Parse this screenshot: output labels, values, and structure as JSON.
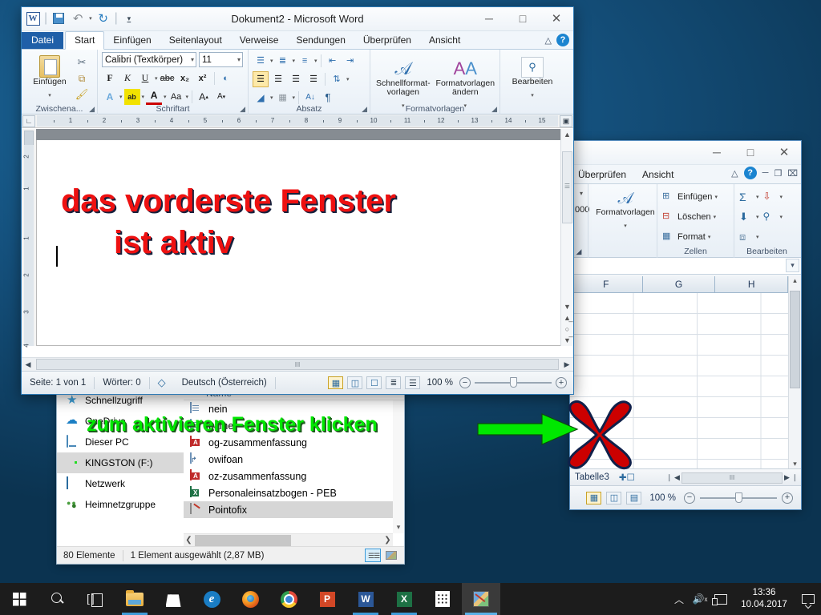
{
  "colors": {
    "annotation_green": "#00E800",
    "annotation_red": "#CC0000",
    "word_red_text": "#EE1111",
    "word_accent": "#2E7AB5",
    "taskbar": "#1C1C1C"
  },
  "word": {
    "title": "Dokument2  -  Microsoft Word",
    "quick_access": [
      {
        "name": "word-logo-icon",
        "label": "W"
      },
      {
        "name": "save-icon",
        "label": "Speichern"
      },
      {
        "name": "undo-icon",
        "label": "Rückgängig"
      },
      {
        "name": "redo-icon",
        "label": "Wiederholen"
      },
      {
        "name": "customize-qat-icon",
        "label": "Symbolleiste anpassen"
      }
    ],
    "window_buttons": {
      "minimize": "─",
      "maximize": "□",
      "close": "✕"
    },
    "tabs": [
      {
        "label": "Datei",
        "type": "file"
      },
      {
        "label": "Start",
        "active": true
      },
      {
        "label": "Einfügen"
      },
      {
        "label": "Seitenlayout"
      },
      {
        "label": "Verweise"
      },
      {
        "label": "Sendungen"
      },
      {
        "label": "Überprüfen"
      },
      {
        "label": "Ansicht"
      }
    ],
    "ribbon": {
      "clipboard": {
        "group_label": "Zwischena...",
        "paste_label": "Einfügen",
        "cut": "Ausschneiden",
        "copy": "Kopieren",
        "format_painter": "Format übertragen"
      },
      "font": {
        "group_label": "Schriftart",
        "font_name": "Calibri (Textkörper)",
        "font_size": "11",
        "bold": "F",
        "italic": "K",
        "underline": "U",
        "strike": "abc",
        "subscript": "x₂",
        "superscript": "x²",
        "clear_format": "Aa",
        "text_effects": "A",
        "highlight": "ab",
        "font_color": "A",
        "change_case": "Aa",
        "grow_font": "A▴",
        "shrink_font": "A▾"
      },
      "paragraph": {
        "group_label": "Absatz",
        "bullets": "Aufzählungszeichen",
        "numbering": "Nummerierung",
        "multilevel": "Liste mit mehreren Ebenen",
        "decrease_indent": "Einzug verkleinern",
        "increase_indent": "Einzug vergrößern",
        "align_left": "Linksbündig",
        "align_center": "Zentriert",
        "align_right": "Rechtsbündig",
        "justify": "Blocksatz",
        "line_spacing": "Zeilenabstand",
        "shading": "Schattierung",
        "borders": "Rahmen",
        "sort": "Sortieren",
        "show_marks": "¶"
      },
      "styles": {
        "group_label": "Formatvorlagen",
        "quick_styles": "Schnellformat-\nvorlagen",
        "quick_styles_l1": "Schnellformat-",
        "quick_styles_l2": "vorlagen",
        "change_styles_l1": "Formatvorlagen",
        "change_styles_l2": "ändern"
      },
      "editing": {
        "group_label": "",
        "edit_label": "Bearbeiten"
      }
    },
    "ruler": {
      "numbers": [
        "1",
        "2",
        "3",
        "4",
        "5",
        "6",
        "7",
        "8",
        "9",
        "10",
        "11",
        "12",
        "13",
        "14",
        "15"
      ],
      "vertical_numbers": [
        "2",
        "1",
        "1",
        "2",
        "3",
        "4"
      ]
    },
    "document": {
      "line1": "das vorderste Fenster",
      "line2": "ist aktiv"
    },
    "status": {
      "page": "Seite: 1 von 1",
      "words": "Wörter: 0",
      "language": "Deutsch (Österreich)",
      "zoom": "100 %",
      "proofing_icon": "proofing-errors-icon",
      "views": [
        "print-layout-view",
        "fullscreen-reading-view",
        "web-layout-view",
        "outline-view",
        "draft-view"
      ]
    }
  },
  "excel": {
    "window_buttons": {
      "minimize": "─",
      "maximize": "□",
      "close": "✕"
    },
    "tabs": [
      {
        "label": "Überprüfen"
      },
      {
        "label": "Ansicht"
      }
    ],
    "tab_right": [
      {
        "name": "collapse-ribbon-icon",
        "label": "△"
      },
      {
        "name": "help-icon",
        "label": "?"
      },
      {
        "name": "minimize-workbook-icon",
        "label": "─"
      },
      {
        "name": "restore-workbook-icon",
        "label": "❐"
      },
      {
        "name": "close-workbook-icon",
        "label": "⌧"
      }
    ],
    "ribbon": {
      "number_partial": "000",
      "styles_label": "Formatvorlagen",
      "cells": {
        "group_label": "Zellen",
        "insert": "Einfügen",
        "delete": "Löschen",
        "format": "Format"
      },
      "editing": {
        "group_label": "Bearbeiten",
        "autosum": "Σ",
        "sort_filter": "Sortieren und Filtern",
        "fill": "Füllbereich",
        "find_select": "Suchen und Auswählen",
        "clear": "Löschen"
      }
    },
    "columns": [
      "F",
      "G",
      "H"
    ],
    "sheet_tab": "Tabelle3",
    "new_sheet_icon": "new-sheet-icon",
    "status": {
      "zoom": "100 %",
      "views": [
        "normal-view",
        "page-layout-view",
        "page-break-view"
      ]
    }
  },
  "explorer": {
    "nav_items": [
      {
        "label": "Schnellzugriff",
        "icon": "star-icon"
      },
      {
        "label": "OneDrive",
        "icon": "cloud-icon"
      },
      {
        "label": "Dieser PC",
        "icon": "computer-icon"
      },
      {
        "label": "KINGSTON (F:)",
        "icon": "usb-drive-icon",
        "selected": true
      },
      {
        "label": "Netzwerk",
        "icon": "network-icon"
      },
      {
        "label": "Heimnetzgruppe",
        "icon": "homegroup-icon"
      }
    ],
    "column_header": "Name",
    "files": [
      {
        "label": "nein",
        "icon": "document-icon"
      },
      {
        "label": "name",
        "icon": "document-icon"
      },
      {
        "label": "og-zusammenfassung",
        "icon": "pdf-icon"
      },
      {
        "label": "owifoan",
        "icon": "shortcut-icon"
      },
      {
        "label": "oz-zusammenfassung",
        "icon": "pdf-icon"
      },
      {
        "label": "Personaleinsatzbogen - PEB",
        "icon": "excel-icon"
      },
      {
        "label": "Pointofix",
        "icon": "pointofix-icon",
        "selected": true
      }
    ],
    "status": {
      "item_count": "80 Elemente",
      "selection": "1 Element ausgewählt (2,87 MB)"
    },
    "view_buttons": [
      {
        "name": "details-view-button",
        "active": true
      },
      {
        "name": "large-icons-view-button",
        "active": false
      }
    ]
  },
  "annotations": {
    "green_text": "zum aktivieren Fenster klicken",
    "arrow": "green-arrow-icon",
    "cross": "red-x-icon"
  },
  "taskbar": {
    "items": [
      {
        "name": "start-button",
        "icon": "windows-logo-icon",
        "label": "Start"
      },
      {
        "name": "search-button",
        "icon": "search-icon",
        "label": "Suchen"
      },
      {
        "name": "task-view-button",
        "icon": "task-view-icon",
        "label": "Taskansicht"
      },
      {
        "name": "file-explorer-button",
        "icon": "folder-icon",
        "label": "Explorer",
        "state": "open"
      },
      {
        "name": "store-button",
        "icon": "store-icon",
        "label": "Store"
      },
      {
        "name": "edge-button",
        "icon": "edge-icon",
        "label": "Microsoft Edge"
      },
      {
        "name": "firefox-button",
        "icon": "firefox-icon",
        "label": "Firefox"
      },
      {
        "name": "chrome-button",
        "icon": "chrome-icon",
        "label": "Google Chrome"
      },
      {
        "name": "powerpoint-button",
        "icon": "powerpoint-icon",
        "label": "PowerPoint"
      },
      {
        "name": "word-button",
        "icon": "word-icon",
        "label": "Word",
        "state": "open"
      },
      {
        "name": "excel-button",
        "icon": "excel-icon",
        "label": "Excel",
        "state": "open"
      },
      {
        "name": "calculator-button",
        "icon": "calculator-icon",
        "label": "Rechner"
      },
      {
        "name": "pointofix-button",
        "icon": "pointofix-icon",
        "label": "Pointofix",
        "state": "active"
      }
    ],
    "tray": [
      {
        "name": "show-hidden-icons-button",
        "icon": "chevron-up-icon",
        "label": "⌃"
      },
      {
        "name": "volume-button",
        "icon": "speaker-muted-icon",
        "label": "⌨"
      },
      {
        "name": "network-button",
        "icon": "network-monitor-icon",
        "label": "Netzwerk"
      }
    ],
    "clock": {
      "time": "13:36",
      "date": "10.04.2017"
    },
    "action_center": {
      "name": "action-center-button",
      "icon": "notification-icon"
    }
  }
}
